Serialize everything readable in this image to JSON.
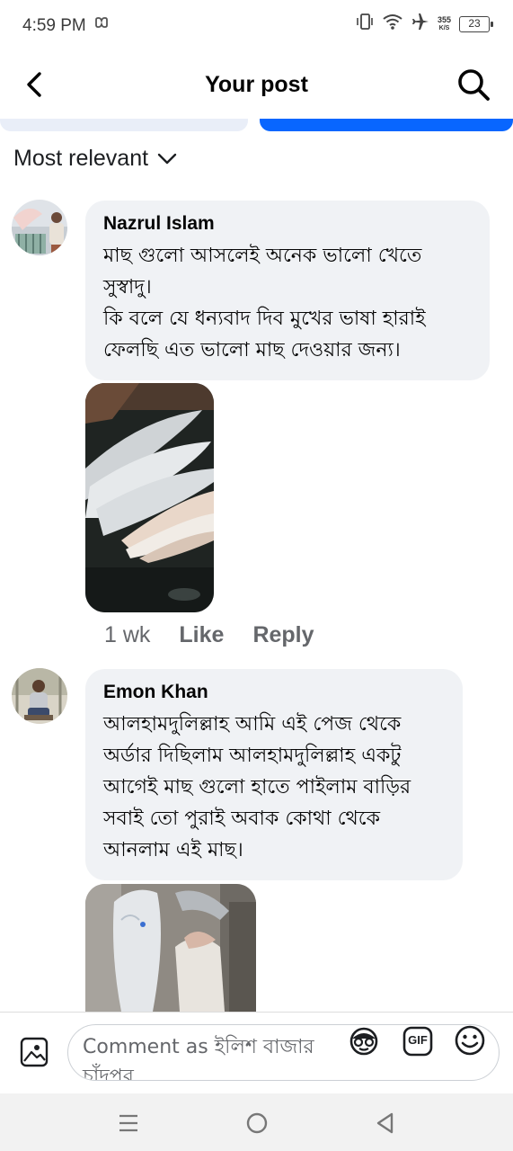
{
  "status": {
    "time": "4:59 PM",
    "net_speed_value": "355",
    "net_speed_unit": "K/S",
    "battery": "23"
  },
  "header": {
    "title": "Your post"
  },
  "sort": {
    "label": "Most relevant"
  },
  "comments": [
    {
      "author": "Nazrul Islam",
      "text": "মাছ গুলো আসলেই অনেক ভালো খেতে সুস্বাদু।\nকি বলে যে ধন্যবাদ দিব মুখের ভাষা হারাই ফেলছি এত ভালো মাছ দেওয়ার জন্য।",
      "time": "1 wk",
      "like_label": "Like",
      "reply_label": "Reply"
    },
    {
      "author": "Emon Khan",
      "text": "আলহামদুলিল্লাহ আমি এই পেজ থেকে অর্ডার দিছিলাম আলহামদুলিল্লাহ একটু আগেই মাছ গুলো হাতে পাইলাম বাড়ির সবাই তো পুরাই অবাক কোথা থেকে আনলাম এই মাছ।"
    }
  ],
  "composer": {
    "placeholder": "Comment as ইলিশ বাজার চাঁদপুর",
    "gif_label": "GIF"
  },
  "icons": {
    "back": "back-arrow-icon",
    "search": "search-icon",
    "sort": "chevron-down-icon",
    "photo": "photo-icon",
    "avatar_sticker": "avatar-sticker-icon",
    "gif": "gif-icon",
    "emoji": "emoji-icon"
  },
  "colors": {
    "accent": "#0866ff",
    "bubble": "#f0f2f5",
    "secondary_text": "#65676b"
  }
}
